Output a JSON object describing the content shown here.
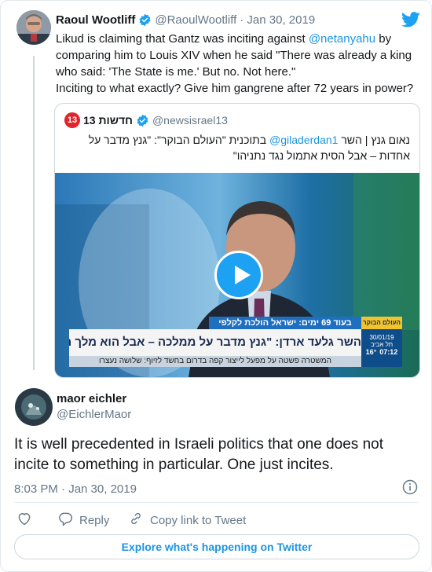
{
  "colors": {
    "accent": "#1da1f2",
    "link": "#1b95e0",
    "muted": "#657786",
    "text": "#14171a"
  },
  "parent_tweet": {
    "name": "Raoul Wootliff",
    "handle": "@RaoulWootliff",
    "date": "· Jan 30, 2019",
    "text_part1": "Likud is claiming that Gantz was inciting against ",
    "mention": "@netanyahu",
    "text_part2": " by comparing him to Louis XIV when he said \"There was already a king who said: 'The State is me.' But no. Not here.\"",
    "text_line2": "Inciting to what exactly? Give him gangrene after 72 years in power?",
    "logo_icon": "twitter-bird-icon"
  },
  "quoted_tweet": {
    "name": "חדשות 13",
    "handle": "@newsisrael13",
    "badge": "13",
    "text_line1_pre": "נאום גנץ | השר ",
    "text_mention": "@giladerdan1",
    "text_line1_post": " בתוכנית \"העולם הבוקר\": \"גנץ מדבר על",
    "text_line2": "אחדות – אבל הסית אתמול נגד נתניהו\"",
    "video": {
      "ticker_top": "בעוד 69 ימים: ישראל הולכת לקלפי",
      "headline": "השר גלעד ארדן: \"גנץ מדבר על ממלכה – אבל הוא מלך השמאל\"",
      "ticker_bottom": "המשטרה פשטה על מפעל לייצור קפה בדרום בחשד לזיוף: שלושה נעצרו",
      "weather_date": "30/01/19",
      "weather_temp": "16°",
      "weather_time": "07:12",
      "weather_city": "תל אביב",
      "show_logo": "העולם הבוקר"
    }
  },
  "reply_tweet": {
    "name": "maor eichler",
    "handle": "@EichlerMaor",
    "text": "It is well precedented in Israeli politics that one does not incite to something in particular. One just incites.",
    "timestamp": "8:03 PM · Jan 30, 2019"
  },
  "actions": {
    "reply_label": "Reply",
    "copy_label": "Copy link to Tweet",
    "explore_label": "Explore what's happening on Twitter"
  }
}
